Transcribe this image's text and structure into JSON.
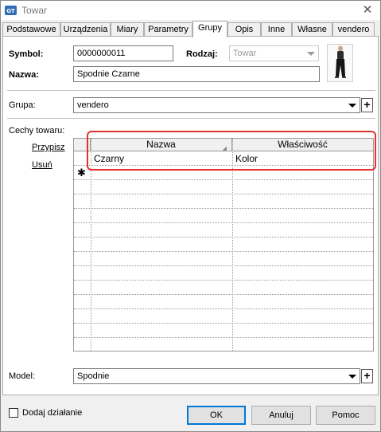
{
  "window": {
    "title": "Towar",
    "app_icon": "gt-logo-icon",
    "close_icon": "close-icon"
  },
  "tabs": [
    {
      "label": "Podstawowe",
      "active": false
    },
    {
      "label": "Urządzenia",
      "active": false
    },
    {
      "label": "Miary",
      "active": false
    },
    {
      "label": "Parametry",
      "active": false
    },
    {
      "label": "Grupy",
      "active": true
    },
    {
      "label": "Opis",
      "active": false
    },
    {
      "label": "Inne",
      "active": false
    },
    {
      "label": "Własne",
      "active": false
    },
    {
      "label": "vendero",
      "active": false
    }
  ],
  "product": {
    "symbol_label": "Symbol:",
    "symbol_value": "0000000011",
    "rodzaj_label": "Rodzaj:",
    "rodzaj_value": "Towar",
    "nazwa_label": "Nazwa:",
    "nazwa_value": "Spodnie Czarne",
    "photo": "trousers-photo"
  },
  "group": {
    "label": "Grupa:",
    "value": "vendero"
  },
  "features": {
    "label": "Cechy towaru:",
    "assign_link": "Przypisz",
    "remove_link": "Usuń",
    "columns": [
      "Nazwa",
      "Właściwość"
    ],
    "rows": [
      {
        "nazwa": "Czarny",
        "wlasciwosc": "Kolor"
      }
    ],
    "new_row_marker": "✱"
  },
  "model": {
    "label": "Model:",
    "value": "Spodnie"
  },
  "footer": {
    "add_action_label": "Dodaj działanie",
    "add_action_checked": false,
    "ok_label": "OK",
    "cancel_label": "Anuluj",
    "help_label": "Pomoc"
  },
  "colors": {
    "highlight": "#e53030",
    "focus": "#0078d7"
  }
}
